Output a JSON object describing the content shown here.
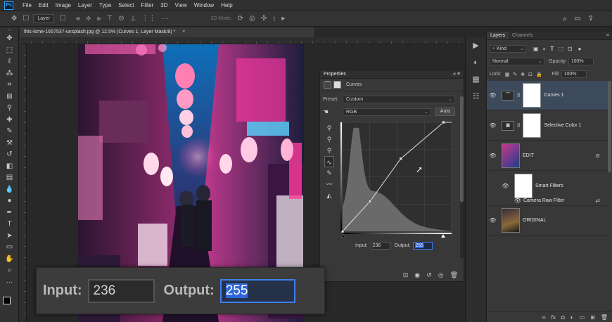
{
  "app": {
    "logo": "Ps"
  },
  "menu": [
    "File",
    "Edit",
    "Image",
    "Layer",
    "Type",
    "Select",
    "Filter",
    "3D",
    "View",
    "Window",
    "Help"
  ],
  "options_bar": {
    "layer_dropdown": "Layer",
    "mode_3d": "3D Mode:"
  },
  "document": {
    "tab_title": "this-isme-1657537-unsplash.jpg @ 12.5% (Curves 1, Layer Mask/8) *",
    "close": "×"
  },
  "properties": {
    "title": "Properties",
    "panel_controls": "«  ≡",
    "adjustment_name": "Curves",
    "preset_label": "Preset:",
    "preset_value": "Custom",
    "channel_value": "RGB",
    "auto_label": "Auto",
    "input_label": "Input:",
    "input_value": "236",
    "output_label": "Output:",
    "output_value": "255"
  },
  "curve_points": [
    {
      "in": 0,
      "out": 0
    },
    {
      "in": 64,
      "out": 70
    },
    {
      "in": 136,
      "out": 170
    },
    {
      "in": 236,
      "out": 255
    }
  ],
  "zoom_callout": {
    "input_label": "Input:",
    "input_value": "236",
    "output_label": "Output:",
    "output_value": "255"
  },
  "layers_panel": {
    "tabs": [
      "Layers",
      "Channels"
    ],
    "filter": "Kind",
    "blend_mode": "Normal",
    "opacity_label": "Opacity:",
    "opacity_value": "100%",
    "lock_label": "Lock:",
    "fill_label": "Fill:",
    "fill_value": "100%",
    "layers": [
      {
        "name": "Curves 1",
        "selected": true
      },
      {
        "name": "Selective Color 1",
        "selected": false
      },
      {
        "name": "EDIT",
        "selected": false
      },
      {
        "name": "Smart Filters",
        "selected": false
      },
      {
        "name": "Camera Raw Filter",
        "selected": false
      },
      {
        "name": "ORIGINAL",
        "selected": false
      }
    ]
  },
  "colors": {
    "accent": "#31a8ff",
    "selection": "#3b7be6",
    "layer_selected": "#3c4a5c"
  }
}
